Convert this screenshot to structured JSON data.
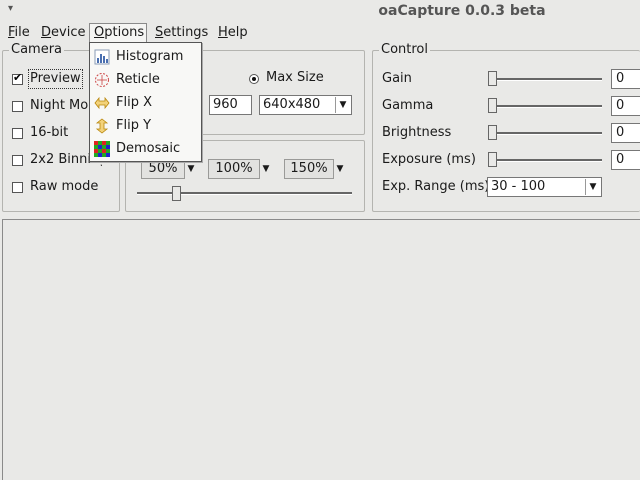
{
  "window": {
    "title": "oaCapture 0.0.3 beta",
    "wm_menu_glyph": "▾"
  },
  "menubar": {
    "items": [
      {
        "label": "File",
        "u": "F",
        "rest": "ile"
      },
      {
        "label": "Device",
        "u": "D",
        "rest": "evice"
      },
      {
        "label": "Options",
        "u": "O",
        "rest": "ptions"
      },
      {
        "label": "Settings",
        "u": "S",
        "rest": "ettings"
      },
      {
        "label": "Help",
        "u": "H",
        "rest": "elp"
      }
    ]
  },
  "options_menu": {
    "items": [
      {
        "label": "Histogram",
        "icon": "histogram-icon"
      },
      {
        "label": "Reticle",
        "icon": "reticle-icon"
      },
      {
        "label": "Flip X",
        "icon": "flip-x-icon"
      },
      {
        "label": "Flip Y",
        "icon": "flip-y-icon"
      },
      {
        "label": "Demosaic",
        "icon": "demosaic-icon"
      }
    ]
  },
  "camera": {
    "title": "Camera",
    "checkboxes": [
      {
        "label": "Preview",
        "checked": true
      },
      {
        "label": "Night Mode",
        "checked": false
      },
      {
        "label": "16-bit",
        "checked": false
      },
      {
        "label": "2x2 Binning",
        "checked": false
      },
      {
        "label": "Raw mode",
        "checked": false
      }
    ]
  },
  "image": {
    "max_size_label": "Max Size",
    "max_size_selected": true,
    "height_value": "960",
    "resolution_selected": "640x480"
  },
  "zoom": {
    "buttons": [
      "50%",
      "100%",
      "150%"
    ],
    "slider_fraction": 0.17
  },
  "control": {
    "title": "Control",
    "sliders": [
      {
        "label": "Gain",
        "value": "0"
      },
      {
        "label": "Gamma",
        "value": "0"
      },
      {
        "label": "Brightness",
        "value": "0"
      },
      {
        "label": "Exposure (ms)",
        "value": "0"
      }
    ],
    "exp_range_label": "Exp. Range (ms)",
    "exp_range_selected": "30 - 100"
  },
  "colors": {
    "background": "#e9e9e7",
    "border": "#b4b4b0"
  }
}
